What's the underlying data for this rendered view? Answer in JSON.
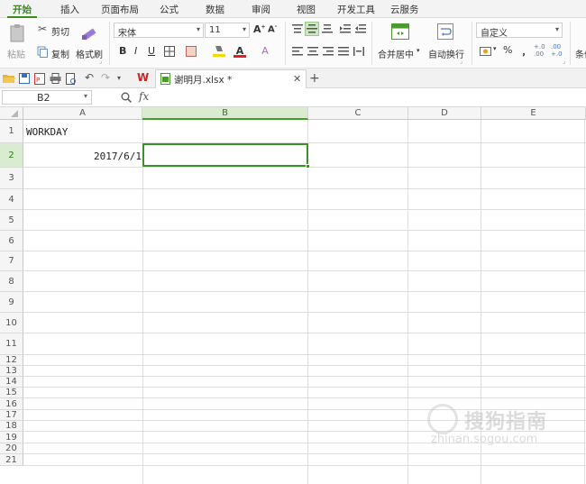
{
  "menu": {
    "tabs": [
      {
        "label": "开始",
        "active": true
      },
      {
        "label": "插入"
      },
      {
        "label": "页面布局"
      },
      {
        "label": "公式"
      },
      {
        "label": "数据"
      },
      {
        "label": "审阅"
      },
      {
        "label": "视图"
      },
      {
        "label": "开发工具"
      },
      {
        "label": "云服务"
      }
    ]
  },
  "ribbon": {
    "paste": "粘贴",
    "cut": "剪切",
    "copy": "复制",
    "format_painter": "格式刷",
    "font_name": "宋体",
    "font_size": "11",
    "bold": "B",
    "italic": "I",
    "underline": "U",
    "merge_center": "合并居中",
    "wrap_text": "自动换行",
    "number_format": "自定义",
    "percent": "%",
    "comma": "﹐",
    "inc_decimal": "+.0 .00",
    "dec_decimal": ".00 +.0",
    "conditional": "条件"
  },
  "document": {
    "filename": "谢明月.xlsx *"
  },
  "formula_bar": {
    "name_box": "B2",
    "fx": "fx",
    "content": ""
  },
  "sheet": {
    "columns": [
      "A",
      "B",
      "C",
      "D",
      "E"
    ],
    "selected_column": "B",
    "rows": [
      "1",
      "2",
      "3",
      "4",
      "5",
      "6",
      "7",
      "8",
      "9",
      "10",
      "11",
      "12",
      "13",
      "14",
      "15",
      "16",
      "17",
      "18",
      "19",
      "20",
      "21"
    ],
    "selected_row": "2",
    "cells": {
      "A1": "WORKDAY",
      "A2": "2017/6/1"
    }
  },
  "watermark": {
    "main": "搜狗指南",
    "sub": "zhinan.sogou.com"
  },
  "colors": {
    "accent": "#3f8f2a",
    "selected_header": "#d9ebd0"
  }
}
